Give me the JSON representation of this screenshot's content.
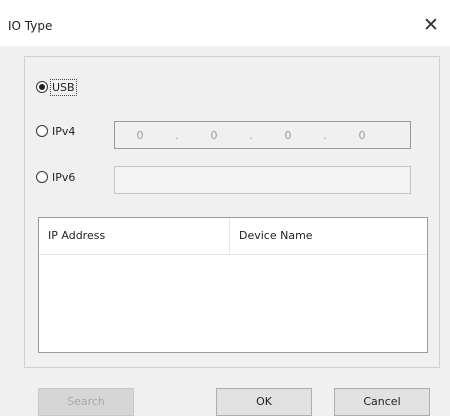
{
  "window": {
    "title": "IO Type",
    "close_glyph": "✕"
  },
  "connection": {
    "options": [
      {
        "label": "USB",
        "selected": true
      },
      {
        "label": "IPv4",
        "selected": false
      },
      {
        "label": "IPv6",
        "selected": false
      }
    ],
    "ipv4": {
      "octets": [
        "0",
        "0",
        "0",
        "0"
      ],
      "separator": "."
    },
    "ipv6": {
      "value": ""
    }
  },
  "device_table": {
    "columns": [
      "IP Address",
      "Device Name"
    ],
    "rows": []
  },
  "buttons": {
    "search": {
      "label": "Search",
      "enabled": false
    },
    "ok": {
      "label": "OK",
      "enabled": true
    },
    "cancel": {
      "label": "Cancel",
      "enabled": true
    }
  }
}
